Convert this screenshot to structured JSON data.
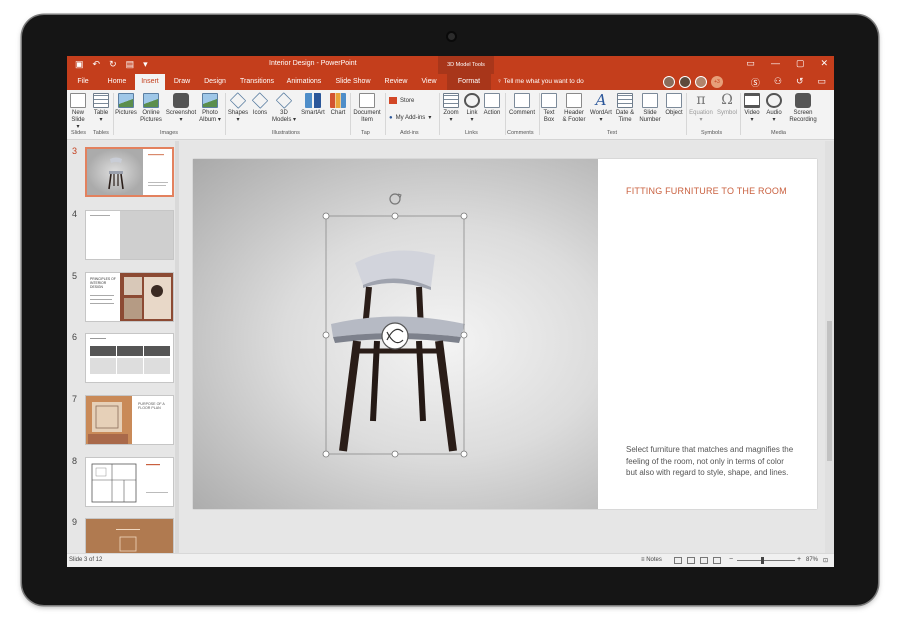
{
  "app": {
    "doc_title": "Interior Design  -  PowerPoint",
    "context_title": "3D Model Tools",
    "window_controls": [
      "▭",
      "—",
      "▢",
      "✕"
    ]
  },
  "tabs": [
    {
      "label": "File"
    },
    {
      "label": "Home"
    },
    {
      "label": "Insert",
      "active": true
    },
    {
      "label": "Draw"
    },
    {
      "label": "Design"
    },
    {
      "label": "Transitions"
    },
    {
      "label": "Animations"
    },
    {
      "label": "Slide Show"
    },
    {
      "label": "Review"
    },
    {
      "label": "View"
    },
    {
      "label": "Format",
      "context": true
    }
  ],
  "tell_me": "Tell me what you want to do",
  "coauthor_more": "+3",
  "ribbon": {
    "buttons": [
      {
        "line1": "New",
        "line2": "Slide ▾"
      },
      {
        "line1": "Table",
        "line2": "▾"
      },
      {
        "line1": "Pictures",
        "line2": ""
      },
      {
        "line1": "Online",
        "line2": "Pictures"
      },
      {
        "line1": "Screenshot",
        "line2": "▾"
      },
      {
        "line1": "Photo",
        "line2": "Album ▾"
      },
      {
        "line1": "Shapes",
        "line2": "▾"
      },
      {
        "line1": "Icons",
        "line2": ""
      },
      {
        "line1": "3D",
        "line2": "Models ▾"
      },
      {
        "line1": "SmartArt",
        "line2": ""
      },
      {
        "line1": "Chart",
        "line2": ""
      },
      {
        "line1": "Document",
        "line2": "Item"
      },
      {
        "line1": "Zoom",
        "line2": "▾"
      },
      {
        "line1": "Link",
        "line2": "▾"
      },
      {
        "line1": "Action",
        "line2": ""
      },
      {
        "line1": "Comment",
        "line2": ""
      },
      {
        "line1": "Text",
        "line2": "Box"
      },
      {
        "line1": "Header",
        "line2": "& Footer"
      },
      {
        "line1": "WordArt",
        "line2": "▾"
      },
      {
        "line1": "Date &",
        "line2": "Time"
      },
      {
        "line1": "Slide",
        "line2": "Number"
      },
      {
        "line1": "Object",
        "line2": ""
      },
      {
        "line1": "Equation",
        "line2": "▾"
      },
      {
        "line1": "Symbol",
        "line2": ""
      },
      {
        "line1": "Video",
        "line2": "▾"
      },
      {
        "line1": "Audio",
        "line2": "▾"
      },
      {
        "line1": "Screen",
        "line2": "Recording"
      }
    ],
    "store": "Store",
    "my_addins": "My Add-ins",
    "groups": [
      "Slides",
      "Tables",
      "Images",
      "Illustrations",
      "Tap",
      "Add-ins",
      "Links",
      "Comments",
      "Text",
      "Symbols",
      "Media"
    ],
    "symbols": {
      "equation": "π",
      "symbol": "Ω",
      "wordart": "A"
    }
  },
  "thumbnails": [
    {
      "num": "3",
      "selected": true
    },
    {
      "num": "4"
    },
    {
      "num": "5",
      "title": "PRINCIPLES OF INTERIOR DESIGN"
    },
    {
      "num": "6"
    },
    {
      "num": "7",
      "title": "PURPOSE OF A FLOOR PLAN"
    },
    {
      "num": "8"
    },
    {
      "num": "9"
    }
  ],
  "slide": {
    "title": "FITTING FURNITURE TO THE ROOM",
    "body": "Select furniture that matches and magnifies the feeling of the room, not only in terms of color but also with regard to style, shape, and lines."
  },
  "status": {
    "slide_info": "Slide 3 of 12",
    "notes": "Notes",
    "zoom": "87%",
    "zoom_minus": "−",
    "zoom_plus": "+"
  }
}
